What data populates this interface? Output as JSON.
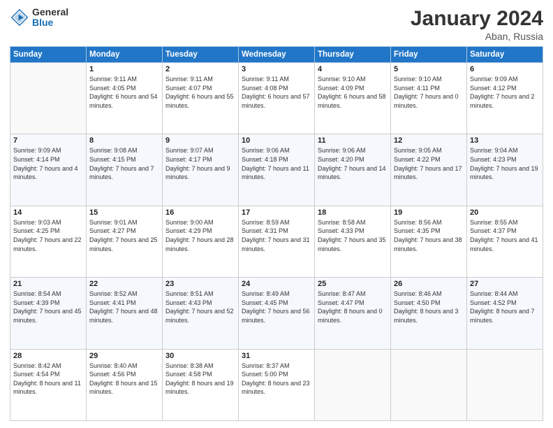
{
  "logo": {
    "general": "General",
    "blue": "Blue"
  },
  "header": {
    "title": "January 2024",
    "location": "Aban, Russia"
  },
  "weekdays": [
    "Sunday",
    "Monday",
    "Tuesday",
    "Wednesday",
    "Thursday",
    "Friday",
    "Saturday"
  ],
  "weeks": [
    [
      {
        "day": "",
        "sunrise": "",
        "sunset": "",
        "daylight": ""
      },
      {
        "day": "1",
        "sunrise": "9:11 AM",
        "sunset": "4:05 PM",
        "daylight": "6 hours and 54 minutes."
      },
      {
        "day": "2",
        "sunrise": "9:11 AM",
        "sunset": "4:07 PM",
        "daylight": "6 hours and 55 minutes."
      },
      {
        "day": "3",
        "sunrise": "9:11 AM",
        "sunset": "4:08 PM",
        "daylight": "6 hours and 57 minutes."
      },
      {
        "day": "4",
        "sunrise": "9:10 AM",
        "sunset": "4:09 PM",
        "daylight": "6 hours and 58 minutes."
      },
      {
        "day": "5",
        "sunrise": "9:10 AM",
        "sunset": "4:11 PM",
        "daylight": "7 hours and 0 minutes."
      },
      {
        "day": "6",
        "sunrise": "9:09 AM",
        "sunset": "4:12 PM",
        "daylight": "7 hours and 2 minutes."
      }
    ],
    [
      {
        "day": "7",
        "sunrise": "9:09 AM",
        "sunset": "4:14 PM",
        "daylight": "7 hours and 4 minutes."
      },
      {
        "day": "8",
        "sunrise": "9:08 AM",
        "sunset": "4:15 PM",
        "daylight": "7 hours and 7 minutes."
      },
      {
        "day": "9",
        "sunrise": "9:07 AM",
        "sunset": "4:17 PM",
        "daylight": "7 hours and 9 minutes."
      },
      {
        "day": "10",
        "sunrise": "9:06 AM",
        "sunset": "4:18 PM",
        "daylight": "7 hours and 11 minutes."
      },
      {
        "day": "11",
        "sunrise": "9:06 AM",
        "sunset": "4:20 PM",
        "daylight": "7 hours and 14 minutes."
      },
      {
        "day": "12",
        "sunrise": "9:05 AM",
        "sunset": "4:22 PM",
        "daylight": "7 hours and 17 minutes."
      },
      {
        "day": "13",
        "sunrise": "9:04 AM",
        "sunset": "4:23 PM",
        "daylight": "7 hours and 19 minutes."
      }
    ],
    [
      {
        "day": "14",
        "sunrise": "9:03 AM",
        "sunset": "4:25 PM",
        "daylight": "7 hours and 22 minutes."
      },
      {
        "day": "15",
        "sunrise": "9:01 AM",
        "sunset": "4:27 PM",
        "daylight": "7 hours and 25 minutes."
      },
      {
        "day": "16",
        "sunrise": "9:00 AM",
        "sunset": "4:29 PM",
        "daylight": "7 hours and 28 minutes."
      },
      {
        "day": "17",
        "sunrise": "8:59 AM",
        "sunset": "4:31 PM",
        "daylight": "7 hours and 31 minutes."
      },
      {
        "day": "18",
        "sunrise": "8:58 AM",
        "sunset": "4:33 PM",
        "daylight": "7 hours and 35 minutes."
      },
      {
        "day": "19",
        "sunrise": "8:56 AM",
        "sunset": "4:35 PM",
        "daylight": "7 hours and 38 minutes."
      },
      {
        "day": "20",
        "sunrise": "8:55 AM",
        "sunset": "4:37 PM",
        "daylight": "7 hours and 41 minutes."
      }
    ],
    [
      {
        "day": "21",
        "sunrise": "8:54 AM",
        "sunset": "4:39 PM",
        "daylight": "7 hours and 45 minutes."
      },
      {
        "day": "22",
        "sunrise": "8:52 AM",
        "sunset": "4:41 PM",
        "daylight": "7 hours and 48 minutes."
      },
      {
        "day": "23",
        "sunrise": "8:51 AM",
        "sunset": "4:43 PM",
        "daylight": "7 hours and 52 minutes."
      },
      {
        "day": "24",
        "sunrise": "8:49 AM",
        "sunset": "4:45 PM",
        "daylight": "7 hours and 56 minutes."
      },
      {
        "day": "25",
        "sunrise": "8:47 AM",
        "sunset": "4:47 PM",
        "daylight": "8 hours and 0 minutes."
      },
      {
        "day": "26",
        "sunrise": "8:46 AM",
        "sunset": "4:50 PM",
        "daylight": "8 hours and 3 minutes."
      },
      {
        "day": "27",
        "sunrise": "8:44 AM",
        "sunset": "4:52 PM",
        "daylight": "8 hours and 7 minutes."
      }
    ],
    [
      {
        "day": "28",
        "sunrise": "8:42 AM",
        "sunset": "4:54 PM",
        "daylight": "8 hours and 11 minutes."
      },
      {
        "day": "29",
        "sunrise": "8:40 AM",
        "sunset": "4:56 PM",
        "daylight": "8 hours and 15 minutes."
      },
      {
        "day": "30",
        "sunrise": "8:38 AM",
        "sunset": "4:58 PM",
        "daylight": "8 hours and 19 minutes."
      },
      {
        "day": "31",
        "sunrise": "8:37 AM",
        "sunset": "5:00 PM",
        "daylight": "8 hours and 23 minutes."
      },
      {
        "day": "",
        "sunrise": "",
        "sunset": "",
        "daylight": ""
      },
      {
        "day": "",
        "sunrise": "",
        "sunset": "",
        "daylight": ""
      },
      {
        "day": "",
        "sunrise": "",
        "sunset": "",
        "daylight": ""
      }
    ]
  ],
  "labels": {
    "sunrise": "Sunrise:",
    "sunset": "Sunset:",
    "daylight": "Daylight:"
  }
}
